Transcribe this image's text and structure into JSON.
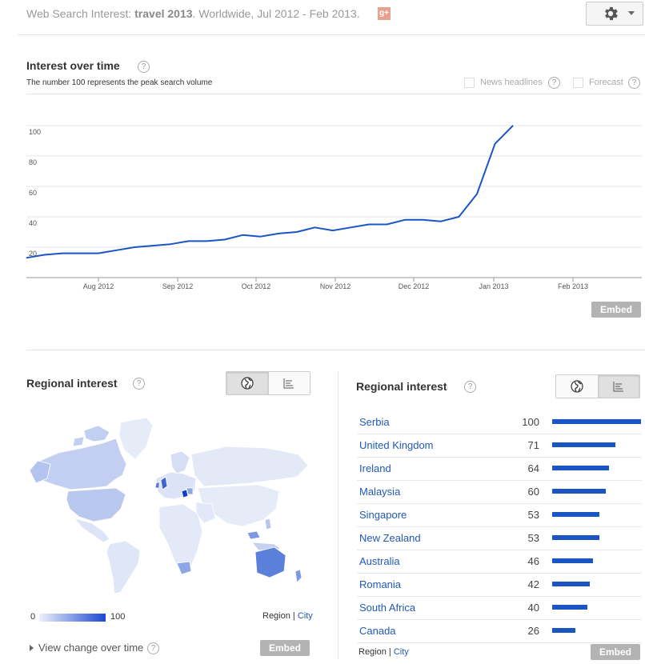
{
  "header": {
    "prefix": "Web Search Interest: ",
    "term": "travel 2013",
    "suffix": ". Worldwide, Jul 2012 - Feb 2013.",
    "gplus_label": "g+"
  },
  "interest": {
    "title": "Interest over time",
    "subtitle": "The number 100 represents the peak search volume",
    "news_label": "News headlines",
    "forecast_label": "Forecast",
    "help": "?",
    "embed_label": "Embed"
  },
  "chart_data": {
    "type": "line",
    "y_ticks": [
      "20",
      "40",
      "60",
      "80",
      "100"
    ],
    "x_ticks": [
      "Aug 2012",
      "Sep 2012",
      "Oct 2012",
      "Nov 2012",
      "Dec 2012",
      "Jan 2013",
      "Feb 2013"
    ],
    "ylim": [
      0,
      100
    ],
    "series": [
      {
        "values": [
          13,
          15,
          16,
          16,
          16,
          18,
          20,
          21,
          22,
          24,
          24,
          25,
          28,
          27,
          29,
          30,
          33,
          31,
          33,
          35,
          35,
          38,
          38,
          37,
          40,
          55,
          88,
          100
        ]
      }
    ],
    "color": "#1a55c4",
    "grid": true
  },
  "regional_left": {
    "title": "Regional interest",
    "help": "?",
    "legend_min": "0",
    "legend_max": "100",
    "region_label": "Region",
    "city_label": "City",
    "view_change": "View change over time",
    "embed_label": "Embed"
  },
  "regional_right": {
    "title": "Regional interest",
    "help": "?",
    "region_label": "Region",
    "city_label": "City",
    "embed_label": "Embed",
    "rows": [
      {
        "name": "Serbia",
        "value": 100
      },
      {
        "name": "United Kingdom",
        "value": 71
      },
      {
        "name": "Ireland",
        "value": 64
      },
      {
        "name": "Malaysia",
        "value": 60
      },
      {
        "name": "Singapore",
        "value": 53
      },
      {
        "name": "New Zealand",
        "value": 53
      },
      {
        "name": "Australia",
        "value": 46
      },
      {
        "name": "Romania",
        "value": 42
      },
      {
        "name": "South Africa",
        "value": 40
      },
      {
        "name": "Canada",
        "value": 26
      }
    ]
  }
}
